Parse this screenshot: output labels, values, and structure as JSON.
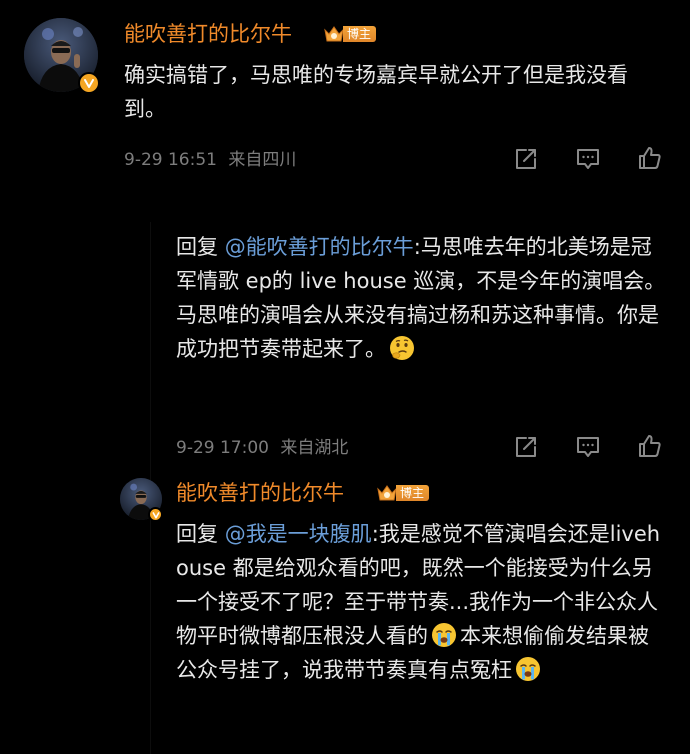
{
  "colors": {
    "background": "#000000",
    "username": "#f08a2a",
    "mention": "#6b9ed8",
    "meta": "#7d7d7d",
    "badge": "#f5a623"
  },
  "comment": {
    "username": "能吹善打的比尔牛",
    "badge_label": "博主",
    "text": "确实搞错了，马思唯的专场嘉宾早就公开了但是我没看到。",
    "time": "9-29 16:51",
    "location": "来自四川"
  },
  "reply1": {
    "prefix": "回复 ",
    "mention": "@能吹善打的比尔牛",
    "text_before_emoji": ":马思唯去年的北美场是冠军情歌 ep的 live house 巡演，不是今年的演唱会。马思唯的演唱会从来没有搞过杨和苏这种事情。你是成功把节奏带起来了。",
    "emoji": "thinking-emoji",
    "time": "9-29 17:00",
    "location": "来自湖北"
  },
  "reply2": {
    "username": "能吹善打的比尔牛",
    "badge_label": "博主",
    "prefix": "回复 ",
    "mention": "@我是一块腹肌",
    "text_part1": ":我是感觉不管演唱会还是livehouse 都是给观众看的吧，既然一个能接受为什么另一个接受不了呢？至于带节奏...我作为一个非公众人物平时微博都压根没人看的",
    "emoji1": "crying-emoji",
    "text_part2": "本来想偷偷发结果被公众号挂了，说我带节奏真有点冤枉",
    "emoji2": "crying-emoji"
  },
  "actions": {
    "share_icon": "share-icon",
    "comment_icon": "comment-icon",
    "like_icon": "like-icon"
  }
}
